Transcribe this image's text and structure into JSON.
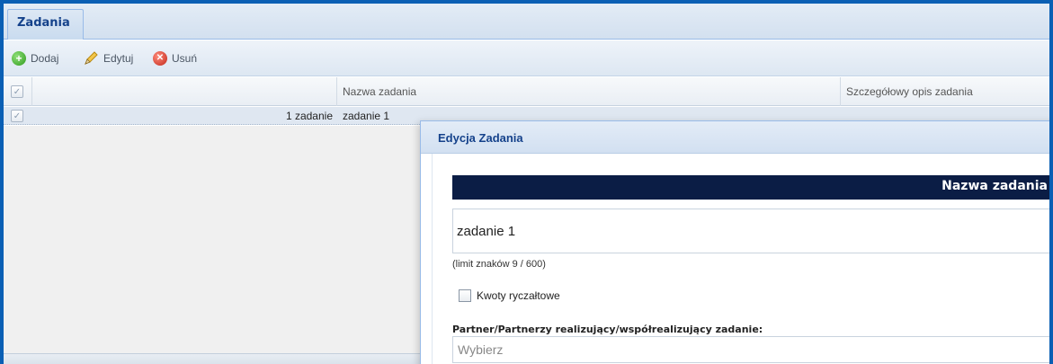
{
  "tabs": [
    {
      "label": "Zadania"
    }
  ],
  "toolbar": {
    "add_label": "Dodaj",
    "edit_label": "Edytuj",
    "delete_label": "Usuń"
  },
  "grid": {
    "columns": [
      "",
      "Nazwa zadania",
      "Szczegółowy opis zadania"
    ],
    "rows": [
      {
        "number": "1 zadanie",
        "name": "zadanie 1",
        "checked": true
      }
    ]
  },
  "dialog": {
    "title": "Edycja Zadania",
    "section_title": "Nazwa zadania",
    "name_value": "zadanie 1",
    "limit_text": "(limit znaków 9 / 600)",
    "lump_sum_label": "Kwoty ryczałtowe",
    "partner_label": "Partner/Partnerzy realizujący/współrealizujący zadanie:",
    "partner_placeholder": "Wybierz"
  },
  "colors": {
    "frame_border": "#0a5fb4",
    "section_bar": "#0b1d45",
    "title_text": "#15428b"
  }
}
